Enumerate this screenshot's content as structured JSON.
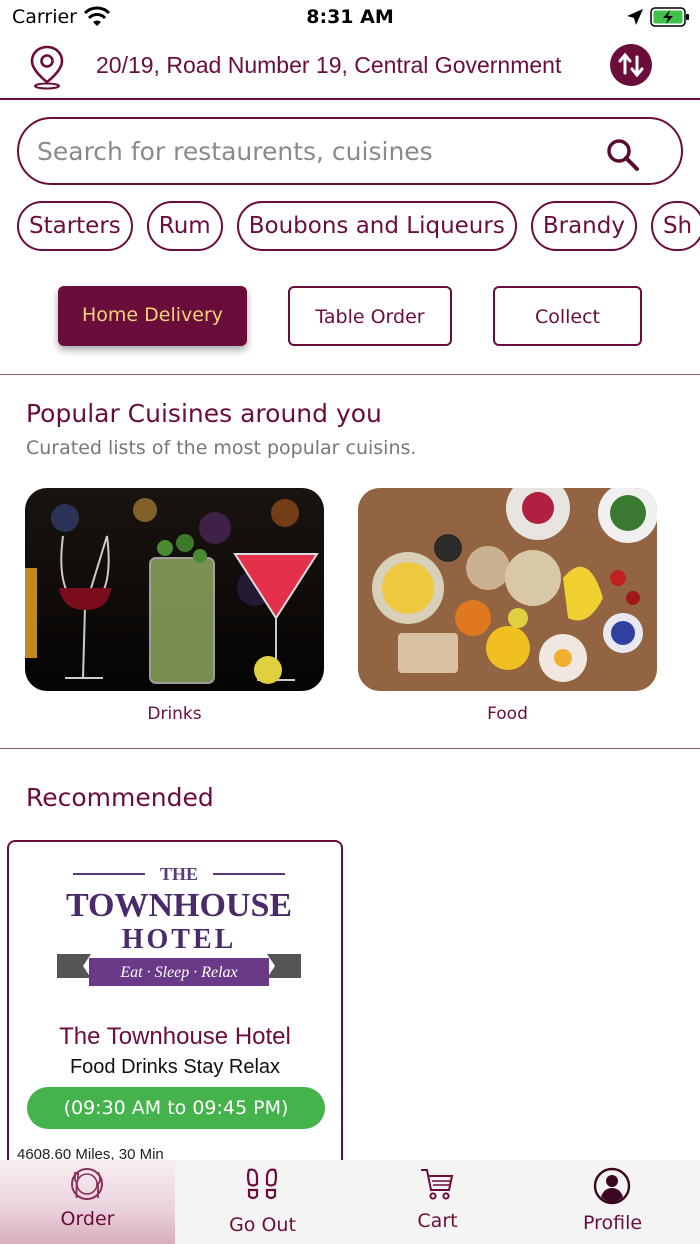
{
  "status_bar": {
    "carrier": "Carrier",
    "time": "8:31 AM"
  },
  "address": {
    "text": "20/19, Road Number 19, Central Government"
  },
  "search": {
    "placeholder": "Search for restaurents, cuisines"
  },
  "categories": [
    "Starters",
    "Rum",
    "Boubons and Liqueurs",
    "Brandy",
    "Sh"
  ],
  "order_modes": {
    "home_delivery": "Home Delivery",
    "table_order": "Table Order",
    "collect": "Collect",
    "active": "Home Delivery"
  },
  "popular": {
    "title": "Popular Cuisines around you",
    "subtitle": "Curated lists of the most popular cuisins.",
    "items": [
      {
        "label": "Drinks"
      },
      {
        "label": "Food"
      }
    ]
  },
  "recommended": {
    "title": "Recommended",
    "items": [
      {
        "logo": {
          "top": "THE",
          "line1": "TOWNHOUSE",
          "line2": "HOTEL",
          "ribbon": "Eat · Sleep · Relax"
        },
        "name": "The Townhouse Hotel",
        "tagline": "Food Drinks Stay Relax",
        "hours": "(09:30 AM to 09:45 PM)",
        "distance": "4608.60 Miles, 30 Min"
      }
    ]
  },
  "tabs": [
    {
      "label": "Order",
      "icon": "plate-cutlery-icon",
      "active": true
    },
    {
      "label": "Go Out",
      "icon": "footprints-icon"
    },
    {
      "label": "Cart",
      "icon": "cart-icon"
    },
    {
      "label": "Profile",
      "icon": "profile-icon"
    }
  ],
  "colors": {
    "brand": "#6b0d3a",
    "accent_text": "#f4d37a",
    "open_green": "#45b34b"
  }
}
